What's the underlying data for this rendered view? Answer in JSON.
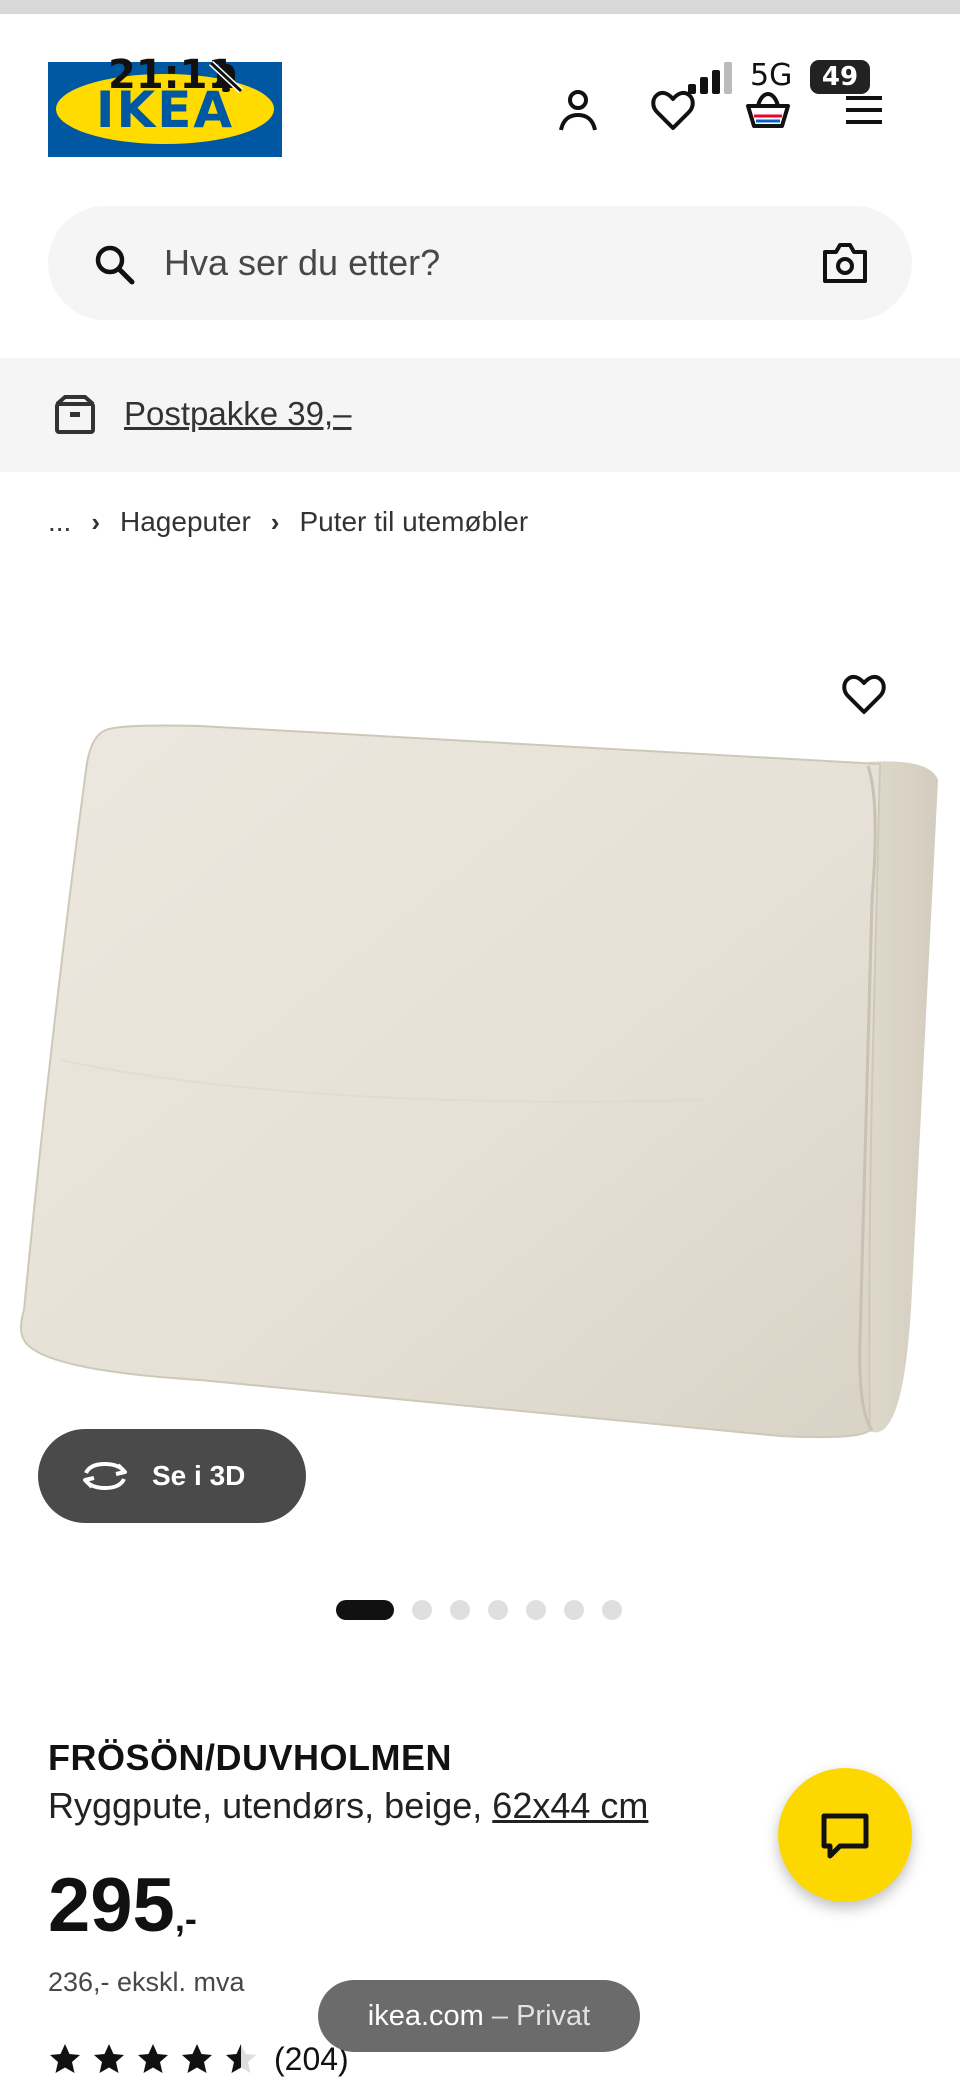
{
  "status_bar": {
    "time": "21:11",
    "network": "5G",
    "battery": "49"
  },
  "header": {
    "logo_text": "IKEA"
  },
  "search": {
    "placeholder": "Hva ser du etter?"
  },
  "banner": {
    "text": "Postpakke 39,–"
  },
  "breadcrumb": {
    "items": [
      "...",
      "Hageputer",
      "Puter til utemøbler"
    ]
  },
  "gallery": {
    "view_3d_label": "Se i 3D",
    "image_count": 7,
    "active_index": 0
  },
  "product": {
    "name": "FRÖSÖN/DUVHOLMEN",
    "description": "Ryggpute, utendørs, beige,",
    "size": "62x44 cm",
    "price": "295",
    "price_suffix": ",-",
    "price_ex_vat": "236,- ekskl. mva",
    "rating": 4.5,
    "review_count": "(204)"
  },
  "browser": {
    "domain": "ikea.com",
    "mode": "– Privat"
  },
  "colors": {
    "ikea_blue": "#0058a3",
    "ikea_yellow": "#ffdb00",
    "chat_yellow": "#fdd800"
  },
  "icons": [
    "bell-slash-icon",
    "person-icon",
    "heart-icon",
    "basket-icon",
    "menu-icon",
    "search-icon",
    "camera-icon",
    "parcel-icon",
    "rotate-3d-icon",
    "chat-icon",
    "star-icon"
  ]
}
